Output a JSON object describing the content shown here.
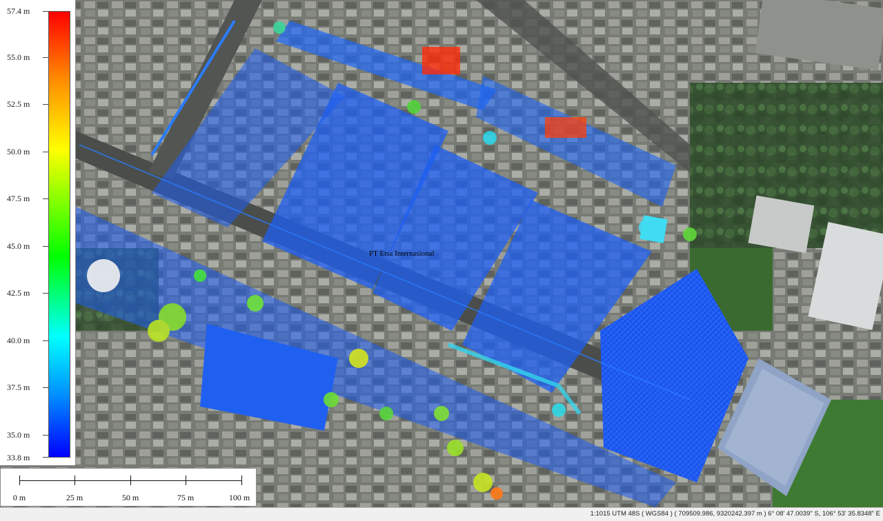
{
  "legend": {
    "top_label": "57.4 m",
    "bottom_label": "33.8 m",
    "labels": [
      "55.0 m",
      "52.5 m",
      "50.0 m",
      "47.5 m",
      "45.0 m",
      "42.5 m",
      "40.0 m",
      "37.5 m",
      "35.0 m"
    ],
    "min_value": 33.8,
    "max_value": 57.4,
    "colors": [
      "#ff0000",
      "#ff8a00",
      "#ffff00",
      "#00ff00",
      "#00ffff",
      "#0090ff",
      "#0000ff"
    ]
  },
  "scale_bar": {
    "labels": [
      "0 m",
      "25 m",
      "50 m",
      "75 m",
      "100 m"
    ]
  },
  "map": {
    "place_label": "PT Etsa Internasional"
  },
  "status_bar": {
    "text": "1:1015  UTM 48S ( WGS84 ) ( 709509.986, 9320242.397 m )  6° 08' 47.0039\" S, 106° 53' 35.8348\" E"
  }
}
